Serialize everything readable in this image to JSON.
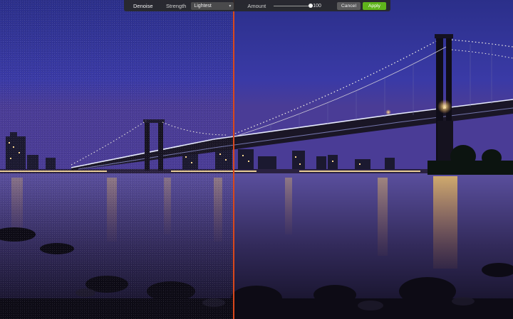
{
  "toolbar": {
    "tool_name": "Denoise",
    "strength_label": "Strength",
    "strength_value": "Lightest",
    "amount_label": "Amount",
    "amount_value": "100",
    "amount_fraction": 1.0,
    "cancel_label": "Cancel",
    "apply_label": "Apply"
  },
  "comparison": {
    "split_color": "#d9481c",
    "apply_color": "#5fb41b"
  }
}
